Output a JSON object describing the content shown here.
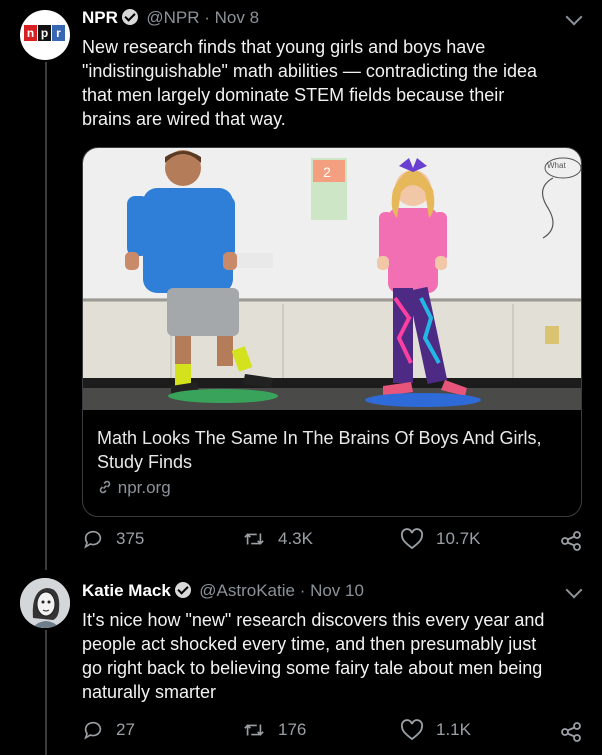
{
  "tweet1": {
    "avatar_logo": [
      "n",
      "p",
      "r"
    ],
    "name": "NPR",
    "handle_date": "@NPR · Nov 8",
    "text_lines": [
      "New research finds that young girls and boys have",
      "\"indistinguishable\" math abilities — contradicting the idea",
      "that men largely dominate STEM fields because their",
      "brains are wired that way."
    ],
    "card": {
      "sign_number": "2",
      "corner_scribble": "What",
      "title": "Math Looks The Same In The Brains Of Boys And Girls, Study Finds",
      "domain": "npr.org"
    },
    "actions": {
      "replies": "375",
      "retweets": "4.3K",
      "likes": "10.7K"
    }
  },
  "tweet2": {
    "name": "Katie Mack",
    "handle_date": "@AstroKatie · Nov 10",
    "text_lines": [
      "It's nice how \"new\" research discovers this every year and",
      "people act shocked every time, and then presumably just",
      "go right back to believing some fairy tale about men being",
      "naturally smarter"
    ],
    "actions": {
      "replies": "27",
      "retweets": "176",
      "likes": "1.1K"
    }
  },
  "icons": [
    "npr-logo",
    "verified-icon",
    "chevron-down-icon",
    "link-icon",
    "reply-icon",
    "retweet-icon",
    "like-icon",
    "share-icon"
  ],
  "colors": {
    "background": "#000000",
    "text": "#ffffff",
    "secondary": "#8b9299",
    "border": "#3a3d40"
  }
}
